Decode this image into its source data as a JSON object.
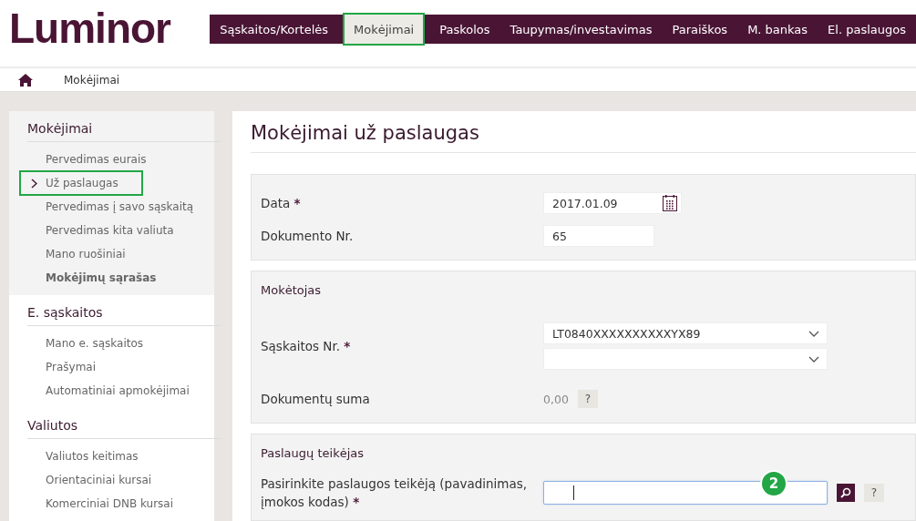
{
  "logo": "Luminor",
  "nav": [
    {
      "label": "Sąskaitos/Kortelės",
      "selected": false,
      "highlighted": false
    },
    {
      "label": "Mokėjimai",
      "selected": true,
      "highlighted": true
    },
    {
      "label": "Paskolos",
      "selected": false,
      "highlighted": false
    },
    {
      "label": "Taupymas/investavimas",
      "selected": false,
      "highlighted": false
    },
    {
      "label": "Paraiškos",
      "selected": false,
      "highlighted": false
    },
    {
      "label": "M. bankas",
      "selected": false,
      "highlighted": false
    },
    {
      "label": "El. paslaugos",
      "selected": false,
      "highlighted": false
    }
  ],
  "breadcrumb": [
    "Mokėjimai"
  ],
  "sidebar": [
    {
      "title": "Mokėjimai",
      "shaded": true,
      "items": [
        {
          "label": "Pervedimas eurais",
          "selected": false,
          "highlighted": false,
          "bold": false
        },
        {
          "label": "Už paslaugas",
          "selected": true,
          "highlighted": true,
          "bold": false
        },
        {
          "label": "Pervedimas į savo sąskaitą",
          "selected": false,
          "highlighted": false,
          "bold": false
        },
        {
          "label": "Pervedimas kita valiuta",
          "selected": false,
          "highlighted": false,
          "bold": false
        },
        {
          "label": "Mano ruošiniai",
          "selected": false,
          "highlighted": false,
          "bold": false
        },
        {
          "label": "Mokėjimų sąrašas",
          "selected": false,
          "highlighted": false,
          "bold": true
        }
      ]
    },
    {
      "title": "E. sąskaitos",
      "shaded": false,
      "items": [
        {
          "label": "Mano e. sąskaitos",
          "selected": false,
          "highlighted": false,
          "bold": false
        },
        {
          "label": "Prašymai",
          "selected": false,
          "highlighted": false,
          "bold": false
        },
        {
          "label": "Automatiniai apmokėjimai",
          "selected": false,
          "highlighted": false,
          "bold": false
        }
      ]
    },
    {
      "title": "Valiutos",
      "shaded": false,
      "items": [
        {
          "label": "Valiutos keitimas",
          "selected": false,
          "highlighted": false,
          "bold": false
        },
        {
          "label": "Orientaciniai kursai",
          "selected": false,
          "highlighted": false,
          "bold": false
        },
        {
          "label": "Komerciniai DNB kursai",
          "selected": false,
          "highlighted": false,
          "bold": false
        }
      ]
    }
  ],
  "page_title": "Mokėjimai už paslaugas",
  "sections": [
    {
      "rows": [
        {
          "kind": "date",
          "label": "Data",
          "required_mark": "*",
          "value": "2017.01.09"
        },
        {
          "kind": "text",
          "label": "Dokumento Nr.",
          "value": "65"
        }
      ]
    },
    {
      "title": "Mokėtojas",
      "rows": [
        {
          "kind": "selects",
          "label": "Sąskaitos Nr.",
          "required_mark": "*",
          "selects": [
            {
              "kind": "filled",
              "value": "LT0840XXXXXXXXXXYX89"
            },
            {
              "kind": "empty"
            }
          ]
        },
        {
          "kind": "amount",
          "label": "Dokumentų suma",
          "value": "0,00",
          "help": "?"
        }
      ]
    },
    {
      "title": "Paslaugų teikėjas",
      "rows": [
        {
          "kind": "search",
          "label": "Pasirinkite paslaugos teikėją (pavadinimas, įmokos kodas)",
          "required_mark": "*",
          "help": "?",
          "focused": true,
          "badge": "2"
        }
      ]
    }
  ]
}
